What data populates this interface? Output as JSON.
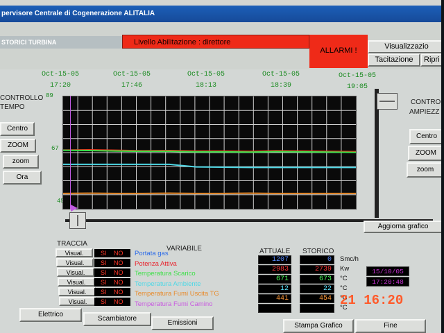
{
  "window": {
    "title": "pervisore Centrale di Cogenerazione ALITALIA"
  },
  "header": {
    "section": "STORICI TURBINA",
    "abilitazione": "Livello Abilitazione :  direttore",
    "allarmi": "ALLARMI !",
    "visualizzazione": "Visualizzazio",
    "tacitazione": "Tacitazione",
    "ripri": "Ripri"
  },
  "timeline": [
    {
      "date": "Oct-15-05",
      "time": "17:20"
    },
    {
      "date": "Oct-15-05",
      "time": "17:46"
    },
    {
      "date": "Oct-15-05",
      "time": "18:13"
    },
    {
      "date": "Oct-15-05",
      "time": "18:39"
    },
    {
      "date": "Oct-15-05",
      "time": "19:05"
    }
  ],
  "left_control": {
    "title_l1": "CONTROLLO",
    "title_l2": "TEMPO",
    "centro": "Centro",
    "zoom_up": "ZOOM",
    "zoom_down": "zoom",
    "ora": "Ora"
  },
  "right_control": {
    "title_l1": "CONTRO",
    "title_l2": "AMPIEZZ",
    "centro": "Centro",
    "zoom_up": "ZOOM",
    "zoom_down": "zoom",
    "aggiorna": "Aggiorna grafico"
  },
  "chart_data": {
    "type": "line",
    "ylim": [
      45,
      89
    ],
    "yticks": [
      89,
      67,
      45
    ],
    "series": [
      {
        "color": "#e83a1e",
        "values": [
          68.0,
          68.1,
          67.9,
          67.7,
          67.8,
          67.6,
          67.6,
          67.5,
          67.7,
          67.6,
          67.5,
          67.4
        ]
      },
      {
        "color": "#3fe04a",
        "values": [
          67.9,
          67.8,
          67.6,
          67.5,
          67.5,
          67.3,
          67.3,
          67.2,
          67.4,
          67.3,
          67.2,
          67.1
        ]
      },
      {
        "color": "#4fd8e6",
        "values": [
          62.4,
          62.4,
          62.4,
          62.4,
          62.4,
          61.4,
          61.3,
          61.2,
          61.2,
          61.2,
          61.2,
          61.2
        ]
      },
      {
        "color": "#e88a2a",
        "values": [
          51.0,
          51.1,
          51.0,
          51.0,
          51.1,
          51.0,
          51.0,
          51.1,
          51.0,
          51.0,
          51.0,
          51.0
        ]
      }
    ]
  },
  "table": {
    "headers": {
      "traccia": "TRACCIA",
      "variabile": "VARIABILE",
      "attuale": "ATTUALE",
      "storico": "STORICO"
    },
    "visual_label": "Visual.",
    "si": "SI",
    "no": "NO",
    "rows": [
      {
        "name": "Portata gas",
        "color": "#2a6ae8",
        "attuale": "1207",
        "storico": "0",
        "unit": "Smc/h",
        "val_color": "#5a8cff"
      },
      {
        "name": "Potenza Attiva",
        "color": "#e8202a",
        "attuale": "2983",
        "storico": "2739",
        "unit": "Kw",
        "val_color": "#ff3a3a"
      },
      {
        "name": "Temperatura Scarico",
        "color": "#3fe04a",
        "attuale": "671",
        "storico": "673",
        "unit": "°C",
        "val_color": "#4aff5a"
      },
      {
        "name": "Temperatura Ambiente",
        "color": "#4fd8e6",
        "attuale": "12",
        "storico": "22",
        "unit": "°C",
        "val_color": "#5ae6ff"
      },
      {
        "name": "Temperatura Fumi Uscita TG",
        "color": "#e88a2a",
        "attuale": "441",
        "storico": "454",
        "unit": "°C",
        "val_color": "#ff9a3a"
      },
      {
        "name": "Temperatura Fumi Camino",
        "color": "#c85ae0",
        "attuale": "",
        "storico": "",
        "unit": "°C",
        "val_color": "#d86aff"
      }
    ],
    "cursor_date": "15/10/05",
    "cursor_time": "17:20:48"
  },
  "footer": {
    "elettrico": "Elettrico",
    "scambiatore": "Scambiatore",
    "emissioni": "Emissioni",
    "stampa": "Stampa Grafico",
    "fine": "Fine"
  },
  "photo_stamp": "21 16:20"
}
